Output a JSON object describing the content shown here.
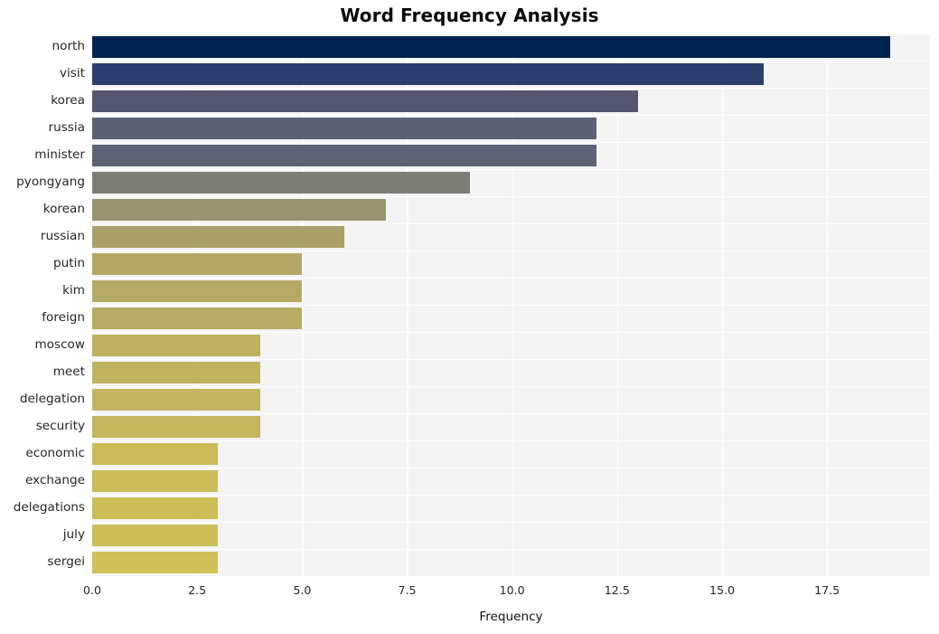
{
  "chart_data": {
    "type": "bar",
    "orientation": "horizontal",
    "title": "Word Frequency Analysis",
    "xlabel": "Frequency",
    "ylabel": "",
    "xlim": [
      0,
      19.95
    ],
    "xticks": [
      "0.0",
      "2.5",
      "5.0",
      "7.5",
      "10.0",
      "12.5",
      "15.0",
      "17.5"
    ],
    "xtick_values": [
      0,
      2.5,
      5,
      7.5,
      10,
      12.5,
      15,
      17.5
    ],
    "grid": true,
    "grid_color": "#ffffff",
    "plot_background": "#f4f4f5",
    "legend": "none",
    "categories": [
      "north",
      "visit",
      "korea",
      "russia",
      "minister",
      "pyongyang",
      "korean",
      "russian",
      "putin",
      "kim",
      "foreign",
      "moscow",
      "meet",
      "delegation",
      "security",
      "economic",
      "exchange",
      "delegations",
      "july",
      "sergei"
    ],
    "values": [
      19,
      16,
      13,
      12,
      12,
      9,
      7,
      6,
      5,
      5,
      5,
      4,
      4,
      4,
      4,
      3,
      3,
      3,
      3,
      3
    ],
    "colors": [
      "#00224e",
      "#2a3f6d",
      "#53566e",
      "#5c6073",
      "#5e6275",
      "#7e7d77",
      "#9a9370",
      "#aaa169",
      "#b3a866",
      "#b5aa65",
      "#b7ac64",
      "#bfb25f",
      "#c0b35e",
      "#c2b55d",
      "#c3b65c",
      "#cabc59",
      "#cbbd58",
      "#ccbe57",
      "#cdbf56",
      "#cfc155"
    ]
  }
}
